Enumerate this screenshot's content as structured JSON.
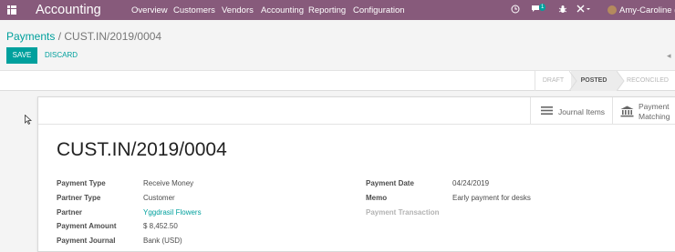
{
  "topbar": {
    "app_title": "Accounting",
    "menu": [
      "Overview",
      "Customers",
      "Vendors",
      "Accounting",
      "Reporting",
      "Configuration"
    ],
    "message_count": "1",
    "user_name": "Amy-Caroline (st"
  },
  "breadcrumb": {
    "parent": "Payments",
    "separator": " / ",
    "current": "CUST.IN/2019/0004"
  },
  "actions": {
    "save": "SAVE",
    "discard": "DISCARD"
  },
  "status_stages": [
    "DRAFT",
    "POSTED",
    "RECONCILED"
  ],
  "active_stage": "POSTED",
  "smart_buttons": {
    "journal_items": "Journal Items",
    "payment_matching_1": "Payment",
    "payment_matching_2": "Matching"
  },
  "record": {
    "name": "CUST.IN/2019/0004",
    "left": [
      {
        "label": "Payment Type",
        "value": "Receive Money"
      },
      {
        "label": "Partner Type",
        "value": "Customer"
      },
      {
        "label": "Partner",
        "value": "Yggdrasil Flowers"
      },
      {
        "label": "Payment Amount",
        "value": "$ 8,452.50"
      },
      {
        "label": "Payment Journal",
        "value": "Bank (USD)"
      }
    ],
    "right": [
      {
        "label": "Payment Date",
        "value": "04/24/2019"
      },
      {
        "label": "Memo",
        "value": "Early payment for desks"
      },
      {
        "label": "Payment Transaction",
        "value": ""
      }
    ]
  },
  "colors": {
    "topbar": "#875a7b",
    "accent": "#00a09d"
  }
}
